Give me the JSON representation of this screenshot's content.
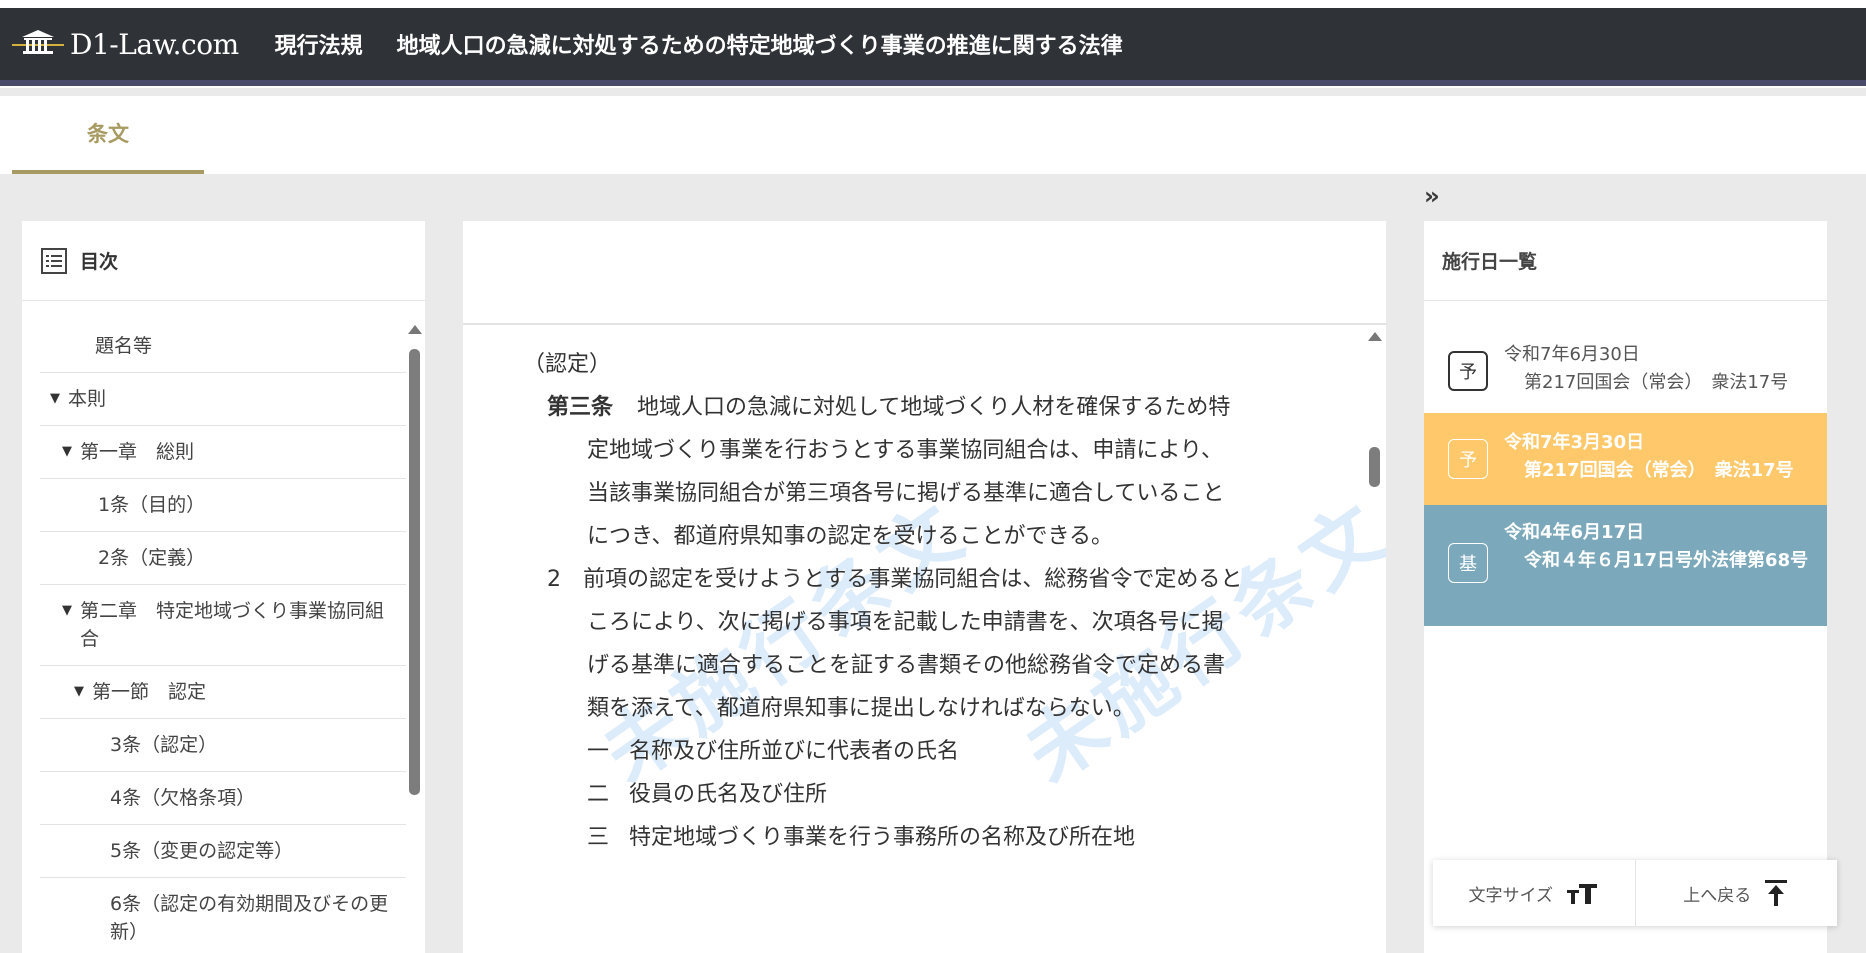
{
  "header": {
    "logo_text": "D1-Law.com",
    "section": "現行法規",
    "law_title": "地域人口の急減に対処するための特定地域づくり事業の推進に関する法律"
  },
  "tabs": [
    {
      "label": "条文",
      "active": true
    }
  ],
  "toc": {
    "title": "目次",
    "items": [
      {
        "label": "題名等",
        "level": 0
      },
      {
        "label": "本則",
        "level": 1,
        "expanded": true
      },
      {
        "label": "第一章　総則",
        "level": 2,
        "expanded": true
      },
      {
        "label": "1条（目的）",
        "level": 3
      },
      {
        "label": "2条（定義）",
        "level": 3
      },
      {
        "label": "第二章　特定地域づくり事業協同組合",
        "level": 2,
        "expanded": true
      },
      {
        "label": "第一節　認定",
        "level": "3c",
        "expanded": true
      },
      {
        "label": "3条（認定）",
        "level": 4
      },
      {
        "label": "4条（欠格条項）",
        "level": 4
      },
      {
        "label": "5条（変更の認定等）",
        "level": 4
      },
      {
        "label": "6条（認定の有効期間及びその更新）",
        "level": 4
      }
    ]
  },
  "article": {
    "caption": "（認定）",
    "number": "第三条",
    "text": "地域人口の急減に対処して地域づくり人材を確保するため特定地域づくり事業を行おうとする事業協同組合は、申請により、当該事業協同組合が第三項各号に掲げる基準に適合していることにつき、都道府県知事の認定を受けることができる。",
    "para2_num": "2",
    "para2_text": "前項の認定を受けようとする事業協同組合は、総務省令で定めるところにより、次に掲げる事項を記載した申請書を、次項各号に掲げる基準に適合することを証する書類その他総務省令で定める書類を添えて、都道府県知事に提出しなければならない。",
    "items": [
      {
        "num": "一",
        "text": "名称及び住所並びに代表者の氏名"
      },
      {
        "num": "二",
        "text": "役員の氏名及び住所"
      },
      {
        "num": "三",
        "text": "特定地域づくり事業を行う事務所の名称及び所在地"
      }
    ],
    "watermark": "未施行条文"
  },
  "effective_dates": {
    "title": "施行日一覧",
    "entries": [
      {
        "badge": "予",
        "date": "令和7年6月30日",
        "detail": "第217回国会（常会）　衆法17号",
        "color": "#ffffff"
      },
      {
        "badge": "予",
        "date": "令和7年3月30日",
        "detail": "第217回国会（常会）　衆法17号",
        "color": "#ffc86a"
      },
      {
        "badge": "基",
        "date": "令和4年6月17日",
        "detail": "令和４年６月17日号外法律第68号",
        "color": "#7ba9bb"
      }
    ]
  },
  "toolbar": {
    "font_size_label": "文字サイズ",
    "back_to_top_label": "上へ戻る"
  }
}
